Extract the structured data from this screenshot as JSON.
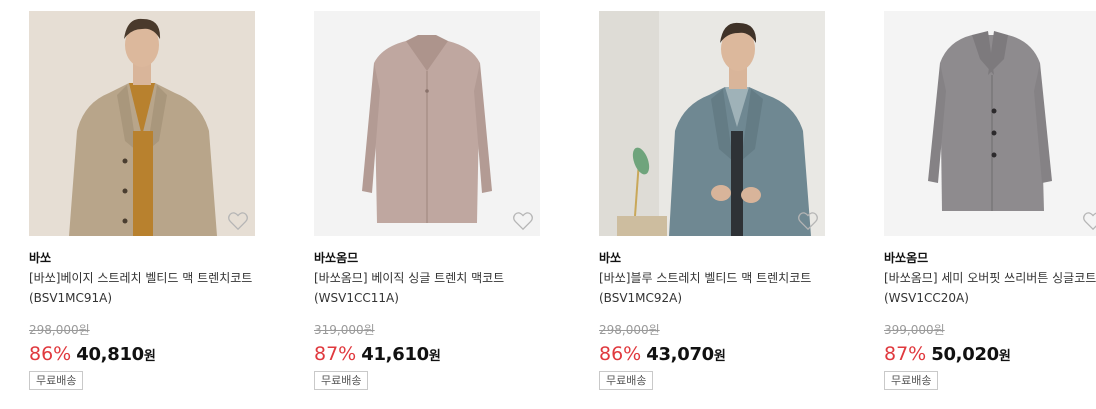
{
  "products": [
    {
      "brand": "바쏘",
      "name": "[바쏘]베이지 스트레치 벨티드 맥 트렌치코트 (BSV1MC91A)",
      "original_price": "298,000원",
      "discount_rate": "86%",
      "sale_price": "40,810",
      "currency": "원",
      "shipping": "무료배송",
      "image": "beige-coat-model"
    },
    {
      "brand": "바쏘옴므",
      "name": "[바쏘옴므] 베이직 싱글 트렌치 맥코트 (WSV1CC11A)",
      "original_price": "319,000원",
      "discount_rate": "87%",
      "sale_price": "41,610",
      "currency": "원",
      "shipping": "무료배송",
      "image": "pink-beige-coat-flat"
    },
    {
      "brand": "바쏘",
      "name": "[바쏘]블루 스트레치 벨티드 맥 트렌치코트 (BSV1MC92A)",
      "original_price": "298,000원",
      "discount_rate": "86%",
      "sale_price": "43,070",
      "currency": "원",
      "shipping": "무료배송",
      "image": "blue-coat-model"
    },
    {
      "brand": "바쏘옴므",
      "name": "[바쏘옴므] 세미 오버핏 쓰리버튼 싱글코트 (WSV1CC20A)",
      "original_price": "399,000원",
      "discount_rate": "87%",
      "sale_price": "50,020",
      "currency": "원",
      "shipping": "무료배송",
      "image": "grey-coat-flat"
    }
  ],
  "colors": {
    "discount": "#e0393e",
    "price": "#111111",
    "strike": "#9a9a9a"
  }
}
